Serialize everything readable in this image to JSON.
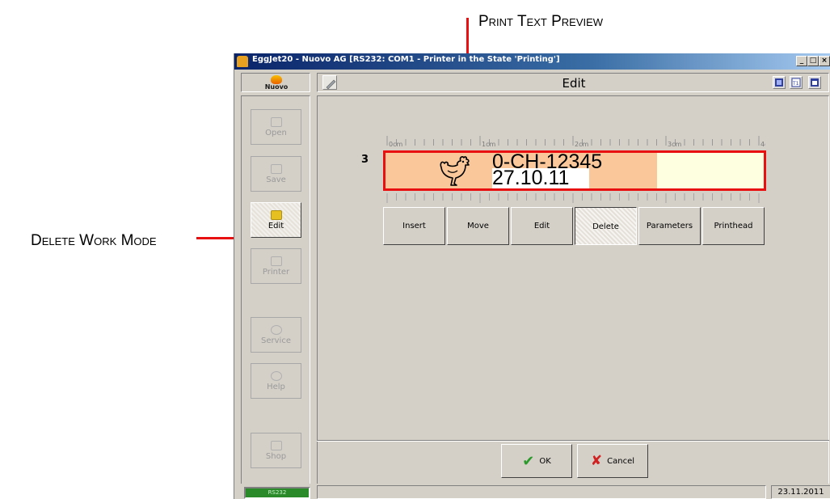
{
  "annotations": {
    "print_text_preview": "Print Text Preview",
    "delete_work_mode": "Delete Work Mode"
  },
  "window": {
    "title": "EggJet20 - Nuovo AG   [RS232: COM1 - Printer in the State 'Printing']",
    "min_label": "_",
    "max_label": "□",
    "close_label": "×"
  },
  "logo": {
    "text": "Nuovo"
  },
  "header": {
    "title": "Edit",
    "icons": [
      "grid-icon",
      "text-icon",
      "window-icon"
    ]
  },
  "sidebar": {
    "items": [
      {
        "label": "Open",
        "icon": "folder-open-icon",
        "active": false
      },
      {
        "label": "Save",
        "icon": "folder-save-icon",
        "active": false
      },
      {
        "label": "Edit",
        "icon": "edit-egg-icon",
        "active": true
      },
      {
        "label": "Printer",
        "icon": "printer-icon",
        "active": false
      },
      {
        "label": "Service",
        "icon": "service-icon",
        "active": false
      },
      {
        "label": "Help",
        "icon": "help-icon",
        "active": false
      },
      {
        "label": "Shop",
        "icon": "shop-icon",
        "active": false
      }
    ]
  },
  "ruler": {
    "labels": [
      "0cm",
      "1cm",
      "2cm",
      "3cm",
      "4cm"
    ]
  },
  "preview": {
    "line_number": "3",
    "line1": "0-CH-12345",
    "line2": "27.10.11",
    "fill_color": "#f9c79a",
    "empty_color": "#fefee0",
    "border_color": "#e81010"
  },
  "toolbar": {
    "buttons": [
      {
        "label": "Insert",
        "active": false
      },
      {
        "label": "Move",
        "active": false
      },
      {
        "label": "Edit",
        "active": false
      },
      {
        "label": "Delete",
        "active": true
      },
      {
        "label": "Parameters",
        "active": false
      },
      {
        "label": "Printhead",
        "active": false
      }
    ]
  },
  "actions": {
    "ok_label": "OK",
    "cancel_label": "Cancel"
  },
  "status": {
    "connection": "RS232",
    "date": "23.11.2011"
  }
}
